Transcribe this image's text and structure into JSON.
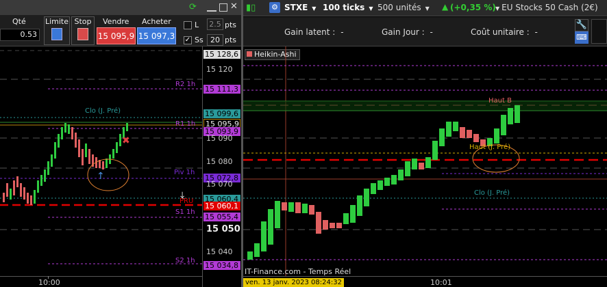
{
  "left_panel": {
    "qty_label": "Qté",
    "qty_value": "0.53",
    "limit_label": "Limite",
    "stop_label": "Stop",
    "sell_label": "Vendre",
    "buy_label": "Acheter",
    "sell_price": "15 095,9",
    "buy_price": "15 097,3",
    "l_label": "L",
    "l_value": "2.5",
    "l_unit": "pts",
    "ss_label": "Ss",
    "ss_value": "20",
    "ss_unit": "pts",
    "levels": {
      "r2": "R2 1h",
      "clo": "Clo (J. Pré)",
      "r1": "R1 1h",
      "piv": "Piv 1h",
      "s1": "S1 1h",
      "s2": "S2 1h",
      "pru": "PRU"
    },
    "time_label": "10:00",
    "axis": {
      "p1": "15 128,6",
      "p2": "15 120",
      "p3": "15 111,3",
      "p4": "15 099,6",
      "p5": "15 095,9",
      "p6": "15 093,9",
      "p7": "15 090",
      "p8": "15 080",
      "p9": "15 072,8",
      "p10": "15 070",
      "p11": "15 060,4",
      "p12": "15 060,1",
      "p13": "15 055,4",
      "p14": "15 050",
      "p15": "15 040",
      "p16": "15 034,8"
    }
  },
  "right_panel": {
    "symbol": "STXE",
    "ticks": "100 ticks",
    "units": "500 unités",
    "change": "(+0,35 %)",
    "instrument": "EU Stocks 50 Cash (2€)",
    "latent_label": "Gain latent :",
    "latent_value": "-",
    "day_label": "Gain Jour :",
    "day_value": "-",
    "unit_cost_label": "Coût unitaire :",
    "unit_cost_value": "-",
    "indicator": "Heikin-Ashi",
    "haut_b": "Haut B",
    "haut_j": "Haut (J. Pré)",
    "clo": "Clo (J. Pré)",
    "footer": "IT-Finance.com - Temps Réel",
    "date": "ven. 13 janv. 2023 08:24:32",
    "time_label": "10:01"
  },
  "colors": {
    "up": "#2ecc40",
    "down": "#e06060",
    "pivot": "#b23bd6",
    "sell": "#d93a3a",
    "buy": "#3a78d9",
    "pru": "#e00000"
  }
}
